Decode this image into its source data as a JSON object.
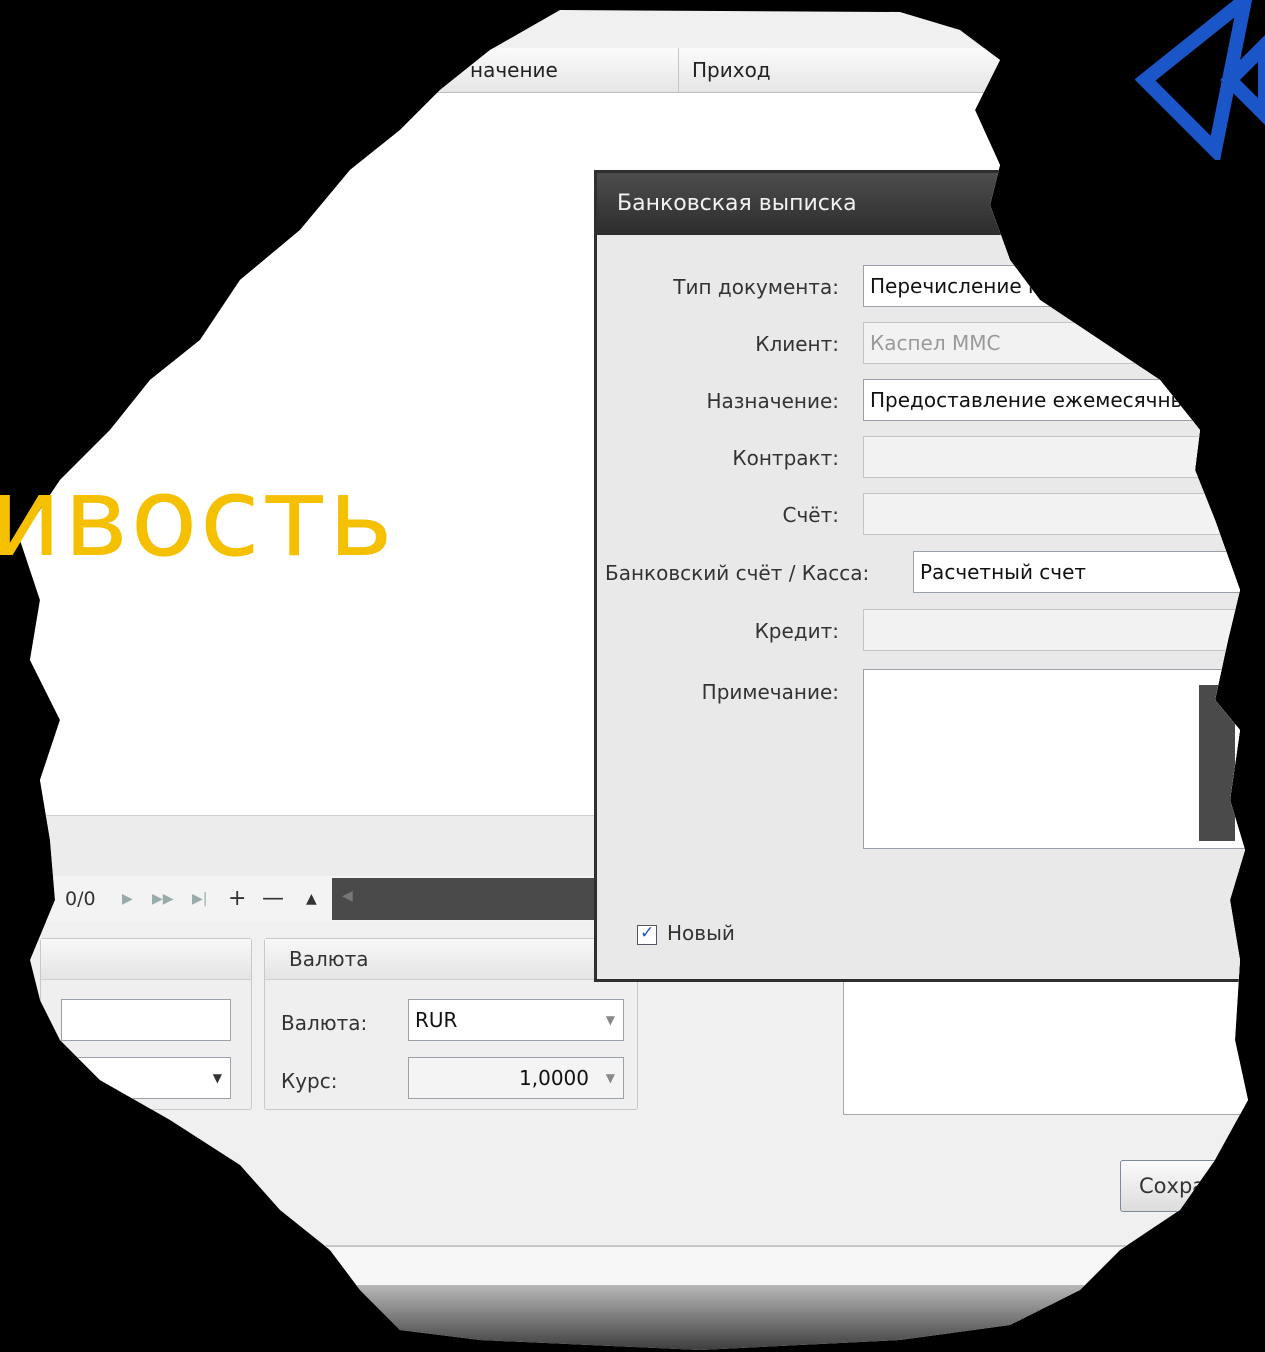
{
  "grid": {
    "columns": [
      "начение",
      "Приход"
    ]
  },
  "overlay_text": "ивость",
  "navigator": {
    "position": "0/0",
    "icons": [
      "next-icon",
      "fast-forward-icon",
      "last-icon",
      "add-icon",
      "remove-icon",
      "up-icon"
    ]
  },
  "currency_group": {
    "title": "Валюта",
    "currency_label": "Валюта:",
    "currency_value": "RUR",
    "rate_label": "Курс:",
    "rate_value": "1,0000"
  },
  "dialog": {
    "title": "Банковская выписка",
    "doc_type_label": "Тип документа:",
    "doc_type_value": "Перечисление на счёт",
    "client_label": "Клиент:",
    "client_value": "Каспел ММС",
    "purpose_label": "Назначение:",
    "purpose_value": "Предоставление ежемесячны",
    "contract_label": "Контракт:",
    "contract_value": "",
    "account_label": "Счёт:",
    "account_value": "",
    "bank_label": "Банковский счёт / Касса:",
    "bank_value": "Расчетный счет",
    "credit_label": "Кредит:",
    "credit_value": "",
    "note_label": "Примечание:",
    "note_value": "",
    "new_checkbox_label": "Новый",
    "new_checked": true
  },
  "save_button_label": "Сохра",
  "colors": {
    "accent_yellow": "#f5c000",
    "logo_blue": "#1a56c8",
    "dialog_title_bg": "#3a3a3a"
  }
}
